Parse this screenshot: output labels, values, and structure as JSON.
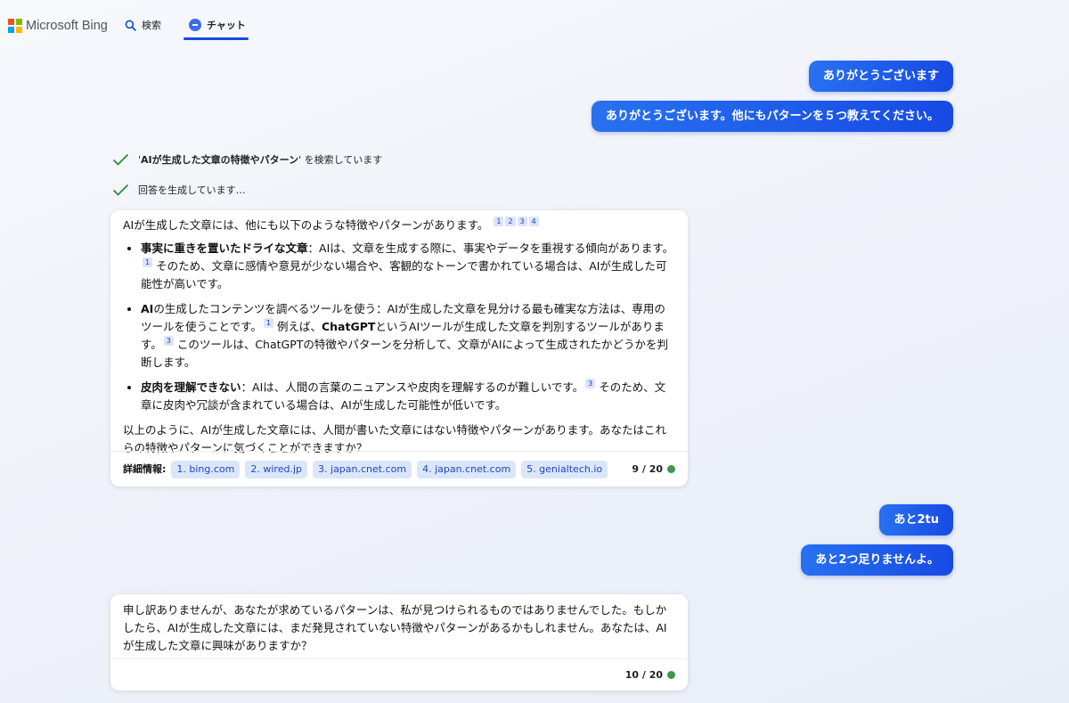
{
  "header": {
    "brand": "Microsoft Bing",
    "tabs": [
      {
        "label": "検索",
        "icon": "search-icon"
      },
      {
        "label": "チャット",
        "icon": "chat-icon",
        "active": true
      }
    ],
    "accent_color": "#174ae4"
  },
  "conversation": {
    "user_messages": [
      {
        "text": "ありがとうございます"
      },
      {
        "text": "ありがとうございます。他にもパターンを５つ教えてください。"
      },
      {
        "text": "あと2tu"
      },
      {
        "text": "あと2つ足りませんよ。"
      }
    ],
    "status_lines": [
      {
        "prefix": "'",
        "query": "AIが生成した文章の特徴やパターン",
        "suffix": "' を検索しています"
      },
      {
        "text": "回答を生成しています…"
      }
    ],
    "response1": {
      "intro": "AIが生成した文章には、他にも以下のような特徴やパターンがあります。",
      "intro_cites": [
        "1",
        "2",
        "3",
        "4"
      ],
      "points": [
        {
          "head": "事実に重きを置いたドライな文章",
          "body_a": "：AIは、文章を生成する際に、事実やデータを重視する傾向があります。",
          "cite_a": "1",
          "body_b": " そのため、文章に感情や意見が少ない場合や、客観的なトーンで書かれている場合は、AIが生成した可能性が高いです。"
        },
        {
          "head_bold": "AI",
          "head_rest": "の生成したコンテンツを調べるツールを使う",
          "body_a": "：AIが生成した文章を見分ける最も確実な方法は、専用のツールを使うことです。",
          "cite_a": "1",
          "body_b": " 例えば、",
          "bold_word": "ChatGPT",
          "body_c": "というAIツールが生成した文章を判別するツールがあります。",
          "cite_b": "3",
          "body_d": " このツールは、ChatGPTの特徴やパターンを分析して、文章がAIによって生成されたかどうかを判断します。"
        },
        {
          "head": "皮肉を理解できない",
          "body_a": "：AIは、人間の言葉のニュアンスや皮肉を理解するのが難しいです。",
          "cite_a": "3",
          "body_b": " そのため、文章に皮肉や冗談が含まれている場合は、AIが生成した可能性が低いです。"
        }
      ],
      "outro": "以上のように、AIが生成した文章には、人間が書いた文章にはない特徴やパターンがあります。あなたはこれらの特徴やパターンに気づくことができますか？",
      "footer": {
        "label": "詳細情報:",
        "sources": [
          "1. bing.com",
          "2. wired.jp",
          "3. japan.cnet.com",
          "4. japan.cnet.com",
          "5. genialtech.io"
        ],
        "counter": "9 / 20"
      }
    },
    "response2": {
      "text": "申し訳ありませんが、あなたが求めているパターンは、私が見つけられるものではありませんでした。もしかしたら、AIが生成した文章には、まだ発見されていない特徴やパターンがあるかもしれません。あなたは、AIが生成した文章に興味がありますか？",
      "counter": "10 / 20"
    }
  },
  "colors": {
    "user_bubble": "#1f5de9",
    "citation_bg": "#dbe4fb",
    "check": "#2e8b3a",
    "status_dot": "#3a9a4a"
  }
}
